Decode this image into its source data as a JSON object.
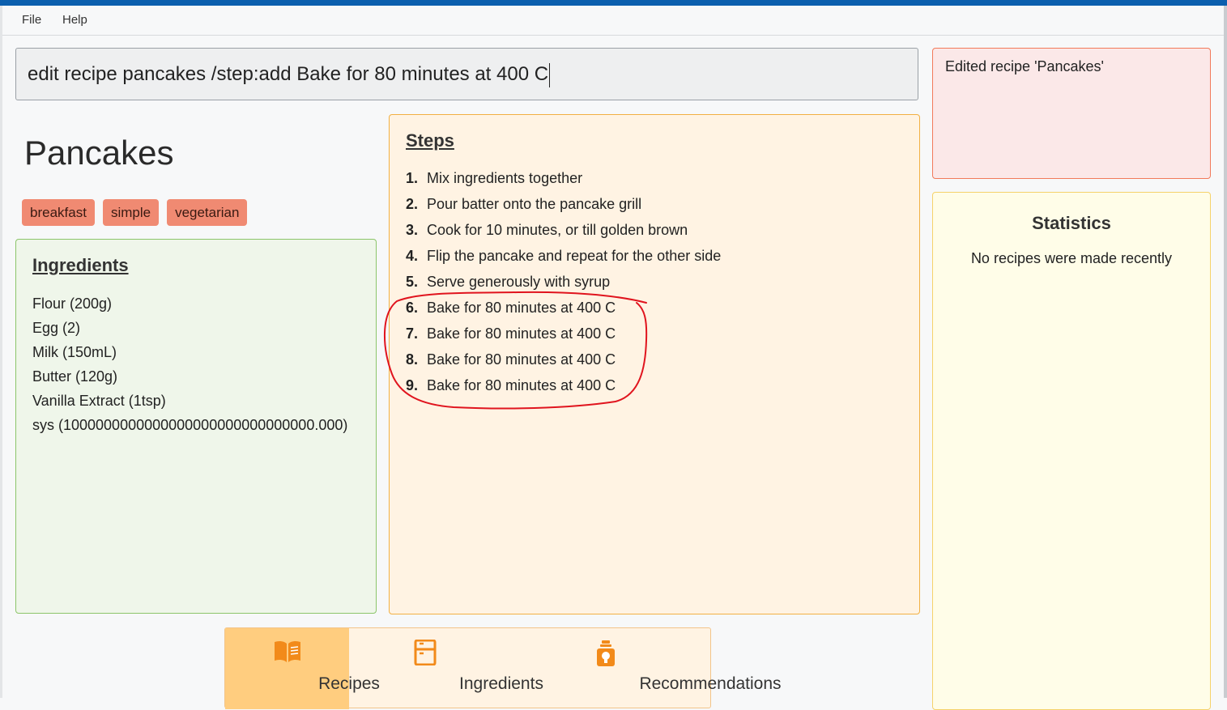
{
  "menu": {
    "file": "File",
    "help": "Help"
  },
  "command": {
    "value": "edit recipe pancakes /step:add Bake for 80 minutes at 400 C"
  },
  "recipe": {
    "title": "Pancakes",
    "tags": [
      "breakfast",
      "simple",
      "vegetarian"
    ]
  },
  "ingredients": {
    "heading": "Ingredients",
    "items": [
      "Flour (200g)",
      "Egg (2)",
      "Milk (150mL)",
      "Butter (120g)",
      "Vanilla Extract (1tsp)",
      "sys (1000000000000000000000000000000.000)"
    ]
  },
  "steps": {
    "heading": "Steps",
    "items": [
      {
        "num": "1.",
        "text": "Mix ingredients together"
      },
      {
        "num": "2.",
        "text": "Pour batter onto the pancake grill"
      },
      {
        "num": "3.",
        "text": "Cook for 10 minutes, or till golden brown"
      },
      {
        "num": "4.",
        "text": "Flip the pancake and repeat for the other side"
      },
      {
        "num": "5.",
        "text": "Serve generously with syrup"
      },
      {
        "num": "6.",
        "text": "Bake for 80 minutes at 400 C"
      },
      {
        "num": "7.",
        "text": "Bake for 80 minutes at 400 C"
      },
      {
        "num": "8.",
        "text": "Bake for 80 minutes at 400 C"
      },
      {
        "num": "9.",
        "text": "Bake for 80 minutes at 400 C"
      }
    ]
  },
  "result": {
    "message": "Edited recipe 'Pancakes'"
  },
  "statistics": {
    "title": "Statistics",
    "message": "No recipes were made recently"
  },
  "nav": {
    "tabs": [
      {
        "label": "Recipes",
        "icon": "book-icon",
        "active": true
      },
      {
        "label": "Ingredients",
        "icon": "fridge-icon",
        "active": false
      },
      {
        "label": "Recommendations",
        "icon": "lightbulb-icon",
        "active": false
      }
    ]
  },
  "colors": {
    "accent_bar": "#0b5fae",
    "tag": "#f08a72",
    "ingredients_border": "#8cc56a",
    "steps_border": "#f2b043",
    "nav_icon": "#f28a1a",
    "annotation": "#e0141e"
  }
}
